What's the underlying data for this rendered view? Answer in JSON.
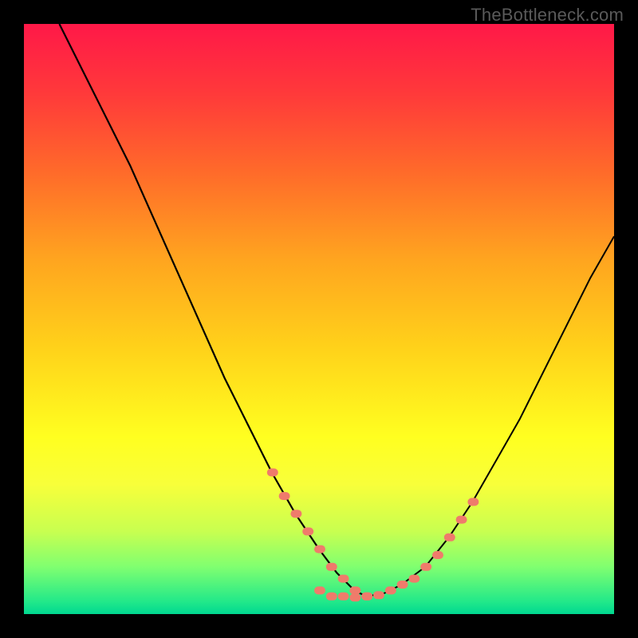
{
  "watermark": "TheBottleneck.com",
  "chart_data": {
    "type": "line",
    "title": "",
    "xlabel": "",
    "ylabel": "",
    "xlim": [
      0,
      100
    ],
    "ylim": [
      0,
      100
    ],
    "grid": false,
    "legend": false,
    "series": [
      {
        "name": "curve-left",
        "stroke": "#000000",
        "x": [
          6,
          10,
          14,
          18,
          22,
          26,
          30,
          34,
          38,
          42,
          46,
          50,
          53,
          56,
          58
        ],
        "y": [
          100,
          92,
          84,
          76,
          67,
          58,
          49,
          40,
          32,
          24,
          17,
          11,
          7,
          4,
          3
        ]
      },
      {
        "name": "curve-right",
        "stroke": "#000000",
        "x": [
          58,
          61,
          64,
          68,
          72,
          76,
          80,
          84,
          88,
          92,
          96,
          100
        ],
        "y": [
          3,
          3.5,
          5,
          8,
          13,
          19,
          26,
          33,
          41,
          49,
          57,
          64
        ]
      },
      {
        "name": "highlight-left",
        "style": "dotted",
        "stroke": "#f08070",
        "x": [
          42,
          44,
          46,
          48,
          50,
          52,
          54,
          56,
          58
        ],
        "y": [
          24,
          20,
          17,
          14,
          11,
          8,
          6,
          4,
          3
        ]
      },
      {
        "name": "highlight-bottom",
        "style": "dotted",
        "stroke": "#f08070",
        "x": [
          50,
          52,
          54,
          56,
          58,
          60,
          62,
          64
        ],
        "y": [
          4,
          3,
          3,
          2.8,
          3,
          3.2,
          4,
          5
        ]
      },
      {
        "name": "highlight-right",
        "style": "dotted",
        "stroke": "#f08070",
        "x": [
          66,
          68,
          70,
          72,
          74,
          76
        ],
        "y": [
          6,
          8,
          10,
          13,
          16,
          19
        ]
      }
    ]
  }
}
